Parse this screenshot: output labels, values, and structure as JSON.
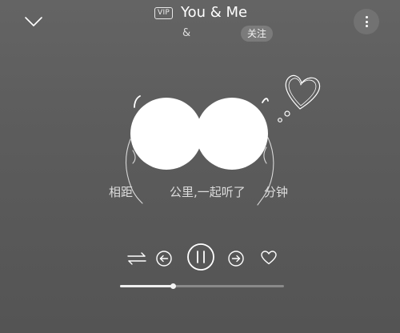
{
  "header": {
    "collapse_icon": "chevron-down-icon",
    "vip_badge": "VIP",
    "song_title": "You & Me",
    "artist": "&",
    "follow_label": "关注",
    "more_icon": "vertical-ellipsis-icon"
  },
  "artwork": {
    "decoration_icon": "sketch-heart-icon"
  },
  "lyric": {
    "parts": [
      "相距",
      "公里,一起听了",
      "分钟"
    ]
  },
  "controls": {
    "shuffle_icon": "loop-arrows-icon",
    "prev_icon": "previous-arrow-icon",
    "play_icon": "pause-icon",
    "next_icon": "next-arrow-icon",
    "like_icon": "heart-outline-icon"
  },
  "playback": {
    "progress_fraction": 0.32
  },
  "colors": {
    "background": "#5d5d5d",
    "foreground": "#ffffff"
  }
}
